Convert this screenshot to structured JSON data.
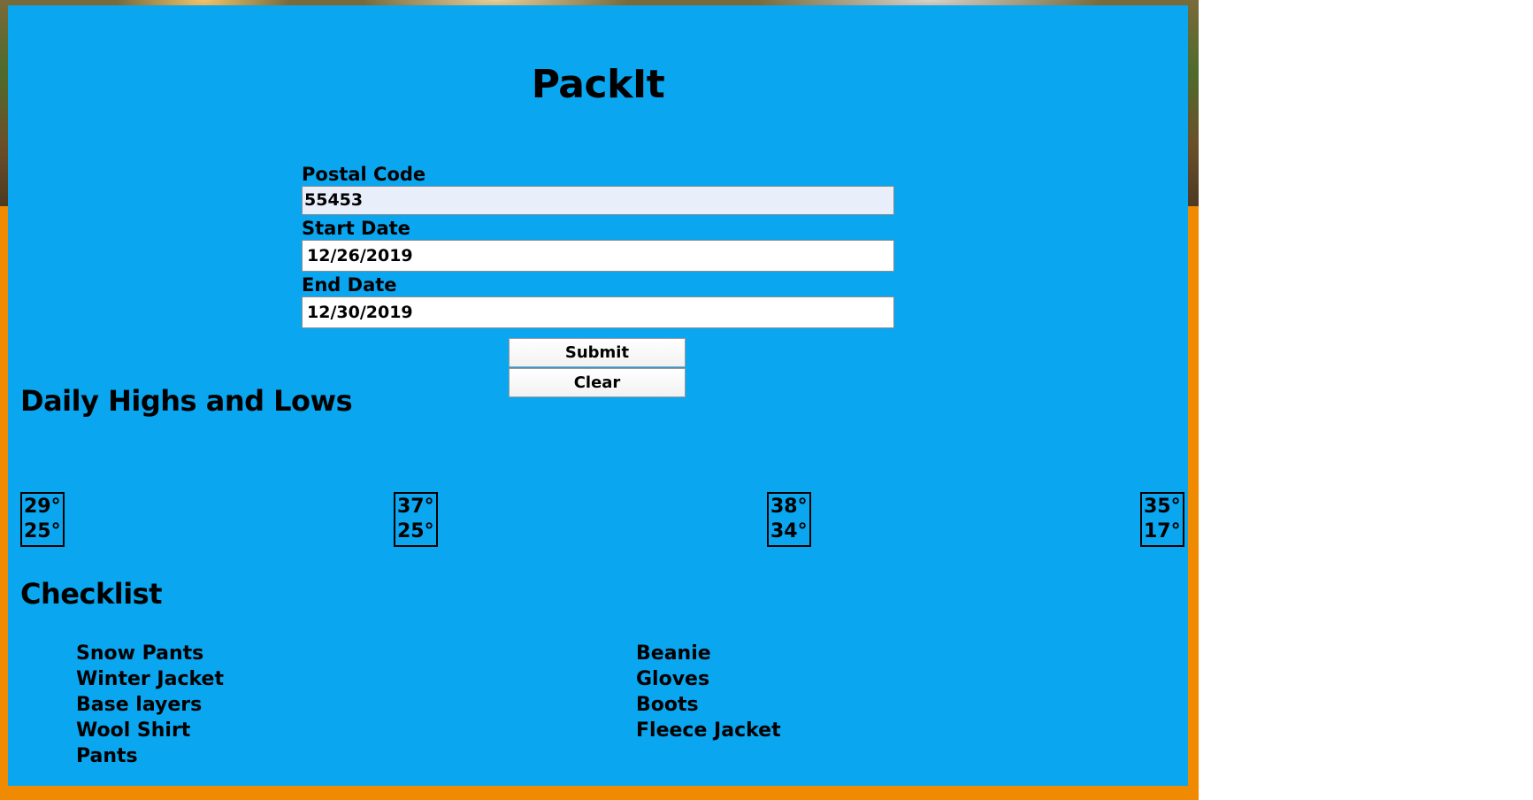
{
  "app": {
    "title": "PackIt"
  },
  "form": {
    "postal_code_label": "Postal Code",
    "postal_code_value": "55453",
    "start_date_label": "Start Date",
    "start_date_value": "12/26/2019",
    "end_date_label": "End Date",
    "end_date_value": "12/30/2019",
    "submit_label": "Submit",
    "clear_label": "Clear"
  },
  "forecast": {
    "heading": "Daily Highs and Lows",
    "days": [
      {
        "high": "29°",
        "low": "25°"
      },
      {
        "high": "37°",
        "low": "25°"
      },
      {
        "high": "38°",
        "low": "34°"
      },
      {
        "high": "35°",
        "low": "17°"
      }
    ]
  },
  "checklist": {
    "heading": "Checklist",
    "left_items": [
      "Snow Pants",
      "Winter Jacket",
      "Base layers",
      "Wool Shirt",
      "Pants"
    ],
    "right_items": [
      "Beanie",
      "Gloves",
      "Boots",
      "Fleece Jacket"
    ]
  },
  "colors": {
    "panel": "#0aa6f0",
    "frame": "#f08a00"
  }
}
